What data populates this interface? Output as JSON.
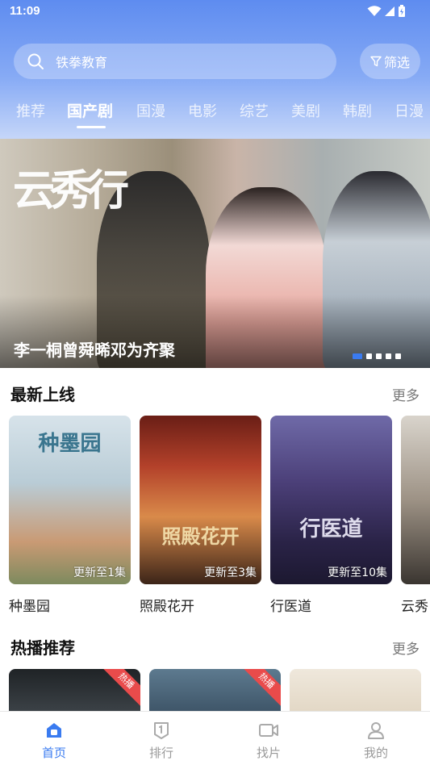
{
  "status_bar": {
    "time": "11:09"
  },
  "search": {
    "text": "铁拳教育",
    "icon": "search-icon"
  },
  "filter": {
    "label": "筛选",
    "icon": "filter-icon"
  },
  "tabs": [
    {
      "label": "推荐"
    },
    {
      "label": "国产剧"
    },
    {
      "label": "国漫"
    },
    {
      "label": "电影"
    },
    {
      "label": "综艺"
    },
    {
      "label": "美剧"
    },
    {
      "label": "韩剧"
    },
    {
      "label": "日漫"
    }
  ],
  "active_tab": "国产剧",
  "banner": {
    "title_art": "云秀行",
    "caption": "李一桐曾舜晞邓为齐聚",
    "slide_count": 5,
    "active_slide": 1
  },
  "latest": {
    "title": "最新上线",
    "more": "更多",
    "items": [
      {
        "name": "种墨园",
        "badge": "更新至1集",
        "art": "种墨园"
      },
      {
        "name": "照殿花开",
        "badge": "更新至3集",
        "art": "照殿花开"
      },
      {
        "name": "行医道",
        "badge": "更新至10集",
        "art": "行医道"
      },
      {
        "name": "云秀",
        "badge": "",
        "art": ""
      }
    ]
  },
  "hot": {
    "title": "热播推荐",
    "more": "更多",
    "tag": "热播"
  },
  "bottom_nav": [
    {
      "label": "首页",
      "icon": "home-icon"
    },
    {
      "label": "排行",
      "icon": "ranking-icon"
    },
    {
      "label": "找片",
      "icon": "video-icon"
    },
    {
      "label": "我的",
      "icon": "profile-icon"
    }
  ],
  "colors": {
    "accent": "#3a7bf0",
    "header_top": "#5e8cf0",
    "hot_tag": "#e94b4b"
  }
}
